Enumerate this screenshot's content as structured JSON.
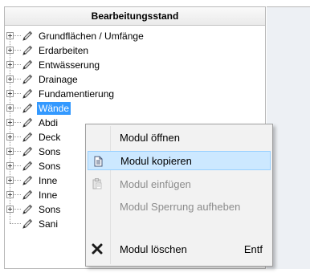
{
  "tree": {
    "header": "Bearbeitungsstand",
    "items": [
      {
        "label": "Grundflächen / Umfänge",
        "expandable": true,
        "selected": false
      },
      {
        "label": "Erdarbeiten",
        "expandable": true,
        "selected": false
      },
      {
        "label": "Entwässerung",
        "expandable": true,
        "selected": false
      },
      {
        "label": "Drainage",
        "expandable": true,
        "selected": false
      },
      {
        "label": "Fundamentierung",
        "expandable": true,
        "selected": false
      },
      {
        "label": "Wände",
        "expandable": true,
        "selected": true
      },
      {
        "label": "Abdi",
        "expandable": true,
        "selected": false
      },
      {
        "label": "Deck",
        "expandable": true,
        "selected": false
      },
      {
        "label": "Sons",
        "expandable": true,
        "selected": false
      },
      {
        "label": "Sons",
        "expandable": true,
        "selected": false
      },
      {
        "label": "Inne",
        "expandable": true,
        "selected": false
      },
      {
        "label": "Inne",
        "expandable": true,
        "selected": false
      },
      {
        "label": "Sons",
        "expandable": true,
        "selected": false
      },
      {
        "label": "Sani",
        "expandable": false,
        "selected": false
      }
    ]
  },
  "context_menu": {
    "items": [
      {
        "label": "Modul öffnen",
        "icon": "",
        "shortcut": "",
        "enabled": true,
        "highlighted": false
      },
      {
        "label": "Modul kopieren",
        "icon": "copy-document-icon",
        "shortcut": "",
        "enabled": true,
        "highlighted": true
      },
      {
        "label": "Modul einfügen",
        "icon": "paste-clipboard-icon",
        "shortcut": "",
        "enabled": false,
        "highlighted": false
      },
      {
        "label": "Modul Sperrung aufheben",
        "icon": "",
        "shortcut": "",
        "enabled": false,
        "highlighted": false
      },
      {
        "label": "Modul löschen",
        "icon": "delete-x-icon",
        "shortcut": "Entf",
        "enabled": true,
        "highlighted": false
      }
    ]
  },
  "colors": {
    "selection": "#3399ff",
    "menu_highlight": "#cce8ff",
    "menu_highlight_border": "#99d1ff",
    "disabled_text": "#8c8c8c",
    "right_panel": "#edf0f4"
  }
}
